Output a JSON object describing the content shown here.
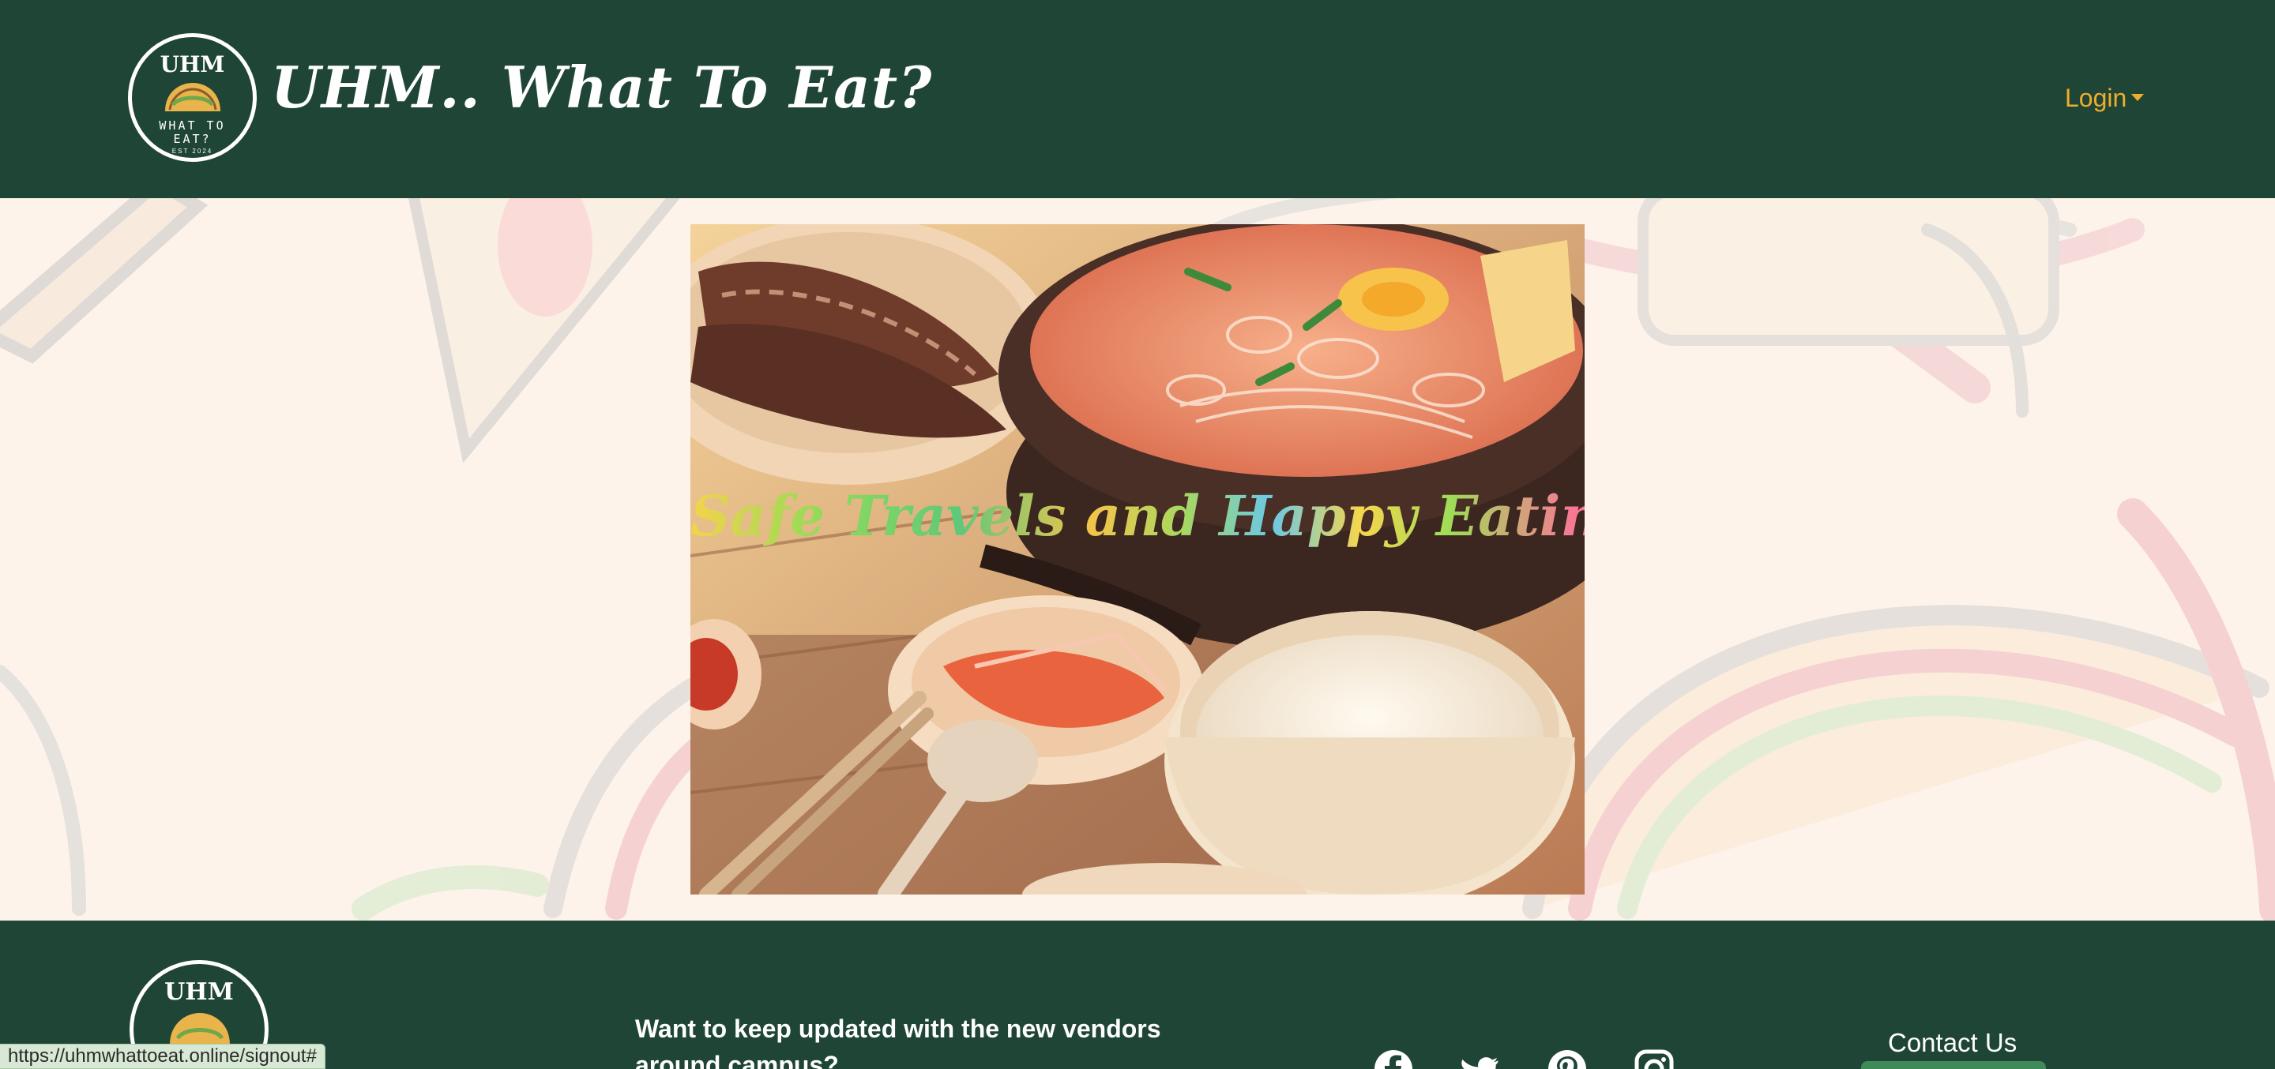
{
  "navbar": {
    "logo": {
      "top_text": "UHM",
      "sub_line1": "WHAT TO",
      "sub_line2": "EAT?",
      "est": "EST 2024"
    },
    "title": "UHM.. What To Eat?",
    "login_label": "Login"
  },
  "hero": {
    "overlay_text": "Safe Travels and Happy Eating!"
  },
  "footer": {
    "logo_text": "UHM",
    "newsletter_text": "Want to keep updated with the new vendors around campus?",
    "social_icons": [
      "facebook-icon",
      "twitter-icon",
      "pinterest-icon",
      "instagram-icon"
    ],
    "contact_label": "Contact Us"
  },
  "status_bar": {
    "url": "https://uhmwhattoeat.online/signout#"
  },
  "colors": {
    "nav_bg": "#1e4535",
    "accent": "#f0ad2c",
    "page_bg": "#fdf3ea",
    "contact_button": "#3f8a58"
  }
}
